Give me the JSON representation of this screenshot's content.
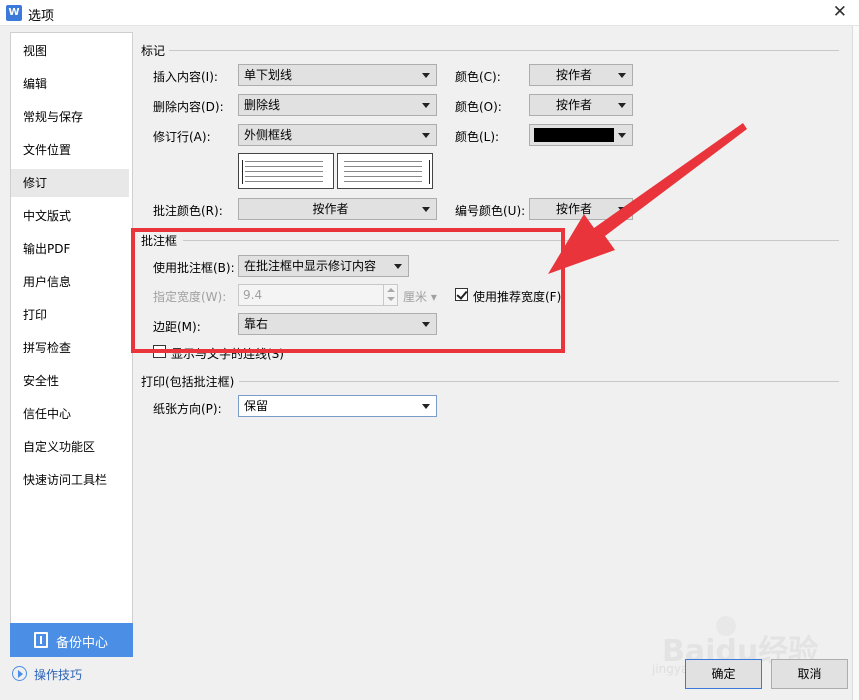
{
  "window": {
    "title": "选项",
    "app_icon": "W"
  },
  "sidebar": {
    "items": [
      {
        "label": "视图"
      },
      {
        "label": "编辑"
      },
      {
        "label": "常规与保存"
      },
      {
        "label": "文件位置"
      },
      {
        "label": "修订",
        "active": true
      },
      {
        "label": "中文版式"
      },
      {
        "label": "输出PDF"
      },
      {
        "label": "用户信息"
      },
      {
        "label": "打印"
      },
      {
        "label": "拼写检查"
      },
      {
        "label": "安全性"
      },
      {
        "label": "信任中心"
      },
      {
        "label": "自定义功能区"
      },
      {
        "label": "快速访问工具栏"
      }
    ],
    "backup_label": "备份中心",
    "tips_label": "操作技巧"
  },
  "markup": {
    "title": "标记",
    "insert_label": "插入内容(I):",
    "insert_value": "单下划线",
    "insert_color_label": "颜色(C):",
    "insert_color_value": "按作者",
    "delete_label": "删除内容(D):",
    "delete_value": "删除线",
    "delete_color_label": "颜色(O):",
    "delete_color_value": "按作者",
    "line_label": "修订行(A):",
    "line_value": "外侧框线",
    "line_color_label": "颜色(L):",
    "line_color_hex": "#000000",
    "comment_color_label": "批注颜色(R):",
    "comment_color_value": "按作者",
    "number_color_label": "编号颜色(U):",
    "number_color_value": "按作者"
  },
  "balloons": {
    "title": "批注框",
    "use_label": "使用批注框(B):",
    "use_value": "在批注框中显示修订内容",
    "width_label": "指定宽度(W):",
    "width_value": "9.4",
    "width_unit": "厘米",
    "recommend_label": "使用推荐宽度(F)",
    "recommend_checked": true,
    "margin_label": "边距(M):",
    "margin_value": "靠右",
    "lines_label": "显示与文字的连线(S)",
    "lines_checked": false
  },
  "print": {
    "title": "打印(包括批注框)",
    "orientation_label": "纸张方向(P):",
    "orientation_value": "保留"
  },
  "buttons": {
    "ok": "确定",
    "cancel": "取消"
  },
  "watermark": {
    "main": "Baidu经验",
    "sub": "jingyan.baidu.com"
  },
  "colors": {
    "highlight": "#e8343a",
    "accent": "#4a8ee6"
  }
}
